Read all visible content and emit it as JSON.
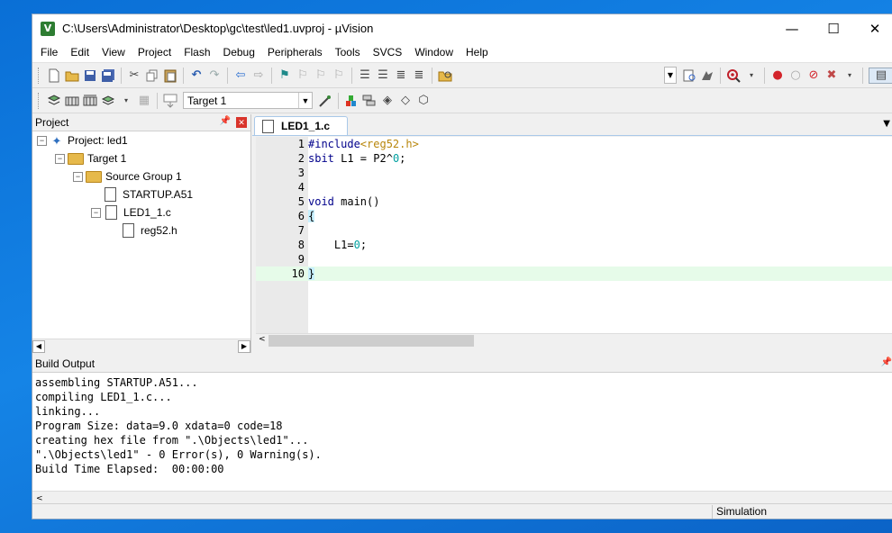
{
  "window": {
    "title": "C:\\Users\\Administrator\\Desktop\\gc\\test\\led1.uvproj - µVision",
    "app_icon": "V",
    "minimize_glyph": "—",
    "maximize_glyph": "☐",
    "close_glyph": "✕"
  },
  "menu": [
    "File",
    "Edit",
    "View",
    "Project",
    "Flash",
    "Debug",
    "Peripherals",
    "Tools",
    "SVCS",
    "Window",
    "Help"
  ],
  "toolbar2": {
    "target_select": "Target 1"
  },
  "project_panel": {
    "title": "Project",
    "tree": {
      "project": "Project: led1",
      "target": "Target 1",
      "group": "Source Group 1",
      "file1": "STARTUP.A51",
      "file2": "LED1_1.c",
      "include": "reg52.h"
    }
  },
  "editor": {
    "tab_label": "LED1_1.c",
    "lines": [
      {
        "no": "1",
        "pp": "#include",
        "rest": "<reg52.h>"
      },
      {
        "no": "2",
        "text": "sbit L1 = P2^0;"
      },
      {
        "no": "3",
        "text": ""
      },
      {
        "no": "4",
        "text": ""
      },
      {
        "no": "5",
        "text": "void main()"
      },
      {
        "no": "6",
        "text": "{"
      },
      {
        "no": "7",
        "text": ""
      },
      {
        "no": "8",
        "text": "    L1=0;"
      },
      {
        "no": "9",
        "text": ""
      },
      {
        "no": "10",
        "text": "}"
      }
    ],
    "current_line": 10
  },
  "build_output": {
    "title": "Build Output",
    "lines": [
      "assembling STARTUP.A51...",
      "compiling LED1_1.c...",
      "linking...",
      "Program Size: data=9.0 xdata=0 code=18",
      "creating hex file from \".\\Objects\\led1\"...",
      "\".\\Objects\\led1\" - 0 Error(s), 0 Warning(s).",
      "Build Time Elapsed:  00:00:00"
    ]
  },
  "status": {
    "mode": "Simulation"
  }
}
